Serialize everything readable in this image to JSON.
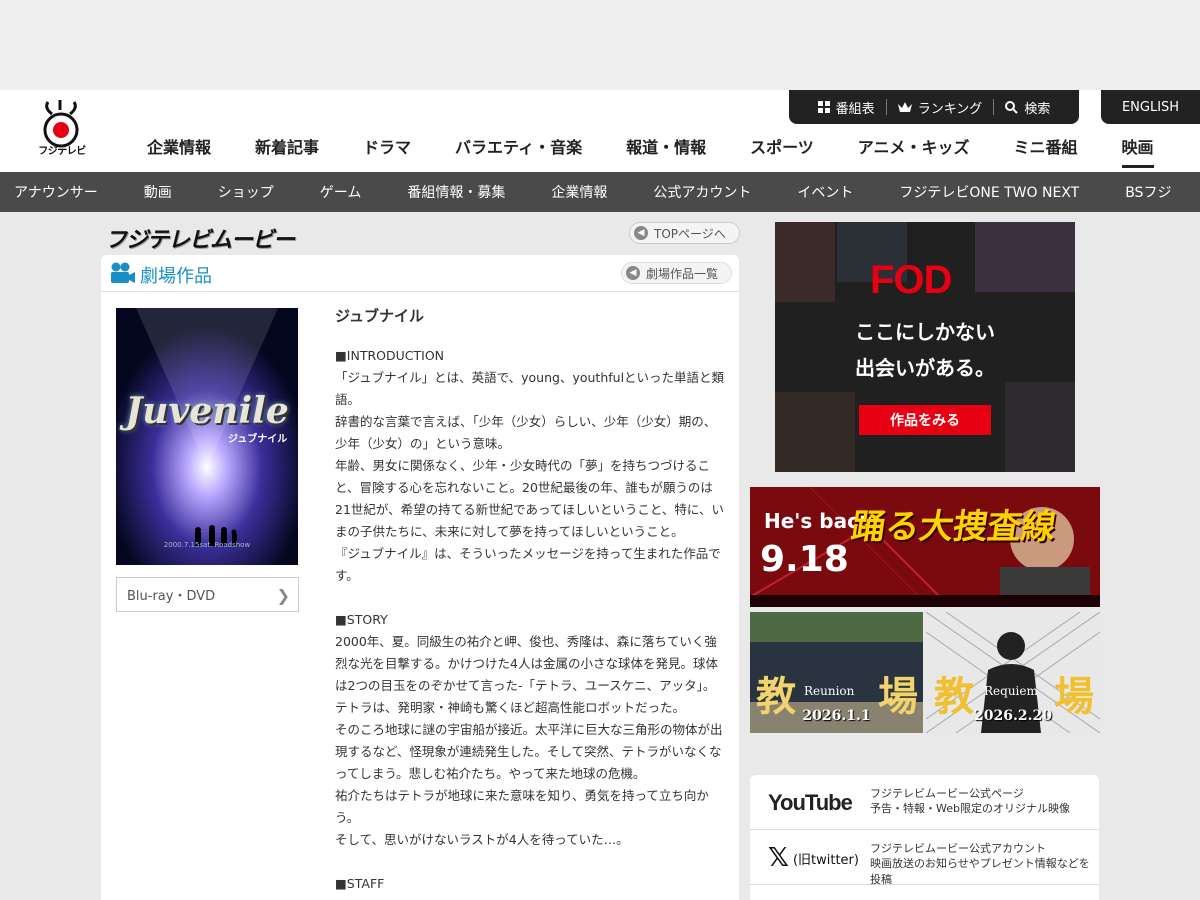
{
  "header": {
    "logo_text": "フジテレビ",
    "util": {
      "schedule": "番組表",
      "ranking": "ランキング",
      "search": "検索",
      "english": "ENGLISH"
    },
    "main_nav": [
      "企業情報",
      "新着記事",
      "ドラマ",
      "バラエティ・音楽",
      "報道・情報",
      "スポーツ",
      "アニメ・キッズ",
      "ミニ番組",
      "映画"
    ],
    "main_nav_active": "映画",
    "sub_nav": [
      "アナウンサー",
      "動画",
      "ショップ",
      "ゲーム",
      "番組情報・募集",
      "企業情報",
      "公式アカウント",
      "イベント",
      "フジテレビONE TWO NEXT",
      "BSフジ"
    ]
  },
  "site": {
    "title": "フジテレビムービー",
    "top_button": "TOPページへ"
  },
  "section": {
    "title": "劇場作品",
    "list_button": "劇場作品一覧"
  },
  "poster": {
    "title": "Juvenile",
    "subtitle": "ジュブナイル",
    "date": "2000.7.15sat. Roadshow"
  },
  "bluray_button": "Blu-ray・DVD",
  "article": {
    "title": "ジュブナイル",
    "intro_head": "■INTRODUCTION",
    "intro": [
      "「ジュブナイル」とは、英語で、young、youthfulといった単語と類語。",
      "辞書的な言葉で言えば、「少年（少女）らしい、少年（少女）期の、少年（少女）の」という意味。",
      "年齢、男女に関係なく、少年・少女時代の「夢」を持ちつづけること、冒険する心を忘れないこと。20世紀最後の年、誰もが願うのは21世紀が、希望の持てる新世紀であってほしいということ、特に、いまの子供たちに、未来に対して夢を持ってほしいということ。",
      "『ジュブナイル』は、そういったメッセージを持って生まれた作品です。"
    ],
    "story_head": "■STORY",
    "story": [
      "2000年、夏。同級生の祐介と岬、俊也、秀隆は、森に落ちていく強烈な光を目撃する。かけつけた4人は金属の小さな球体を発見。球体は2つの目玉をのぞかせて言った-「テトラ、ユースケニ、アッタ」。テトラは、発明家・神崎も驚くほど超高性能ロボットだった。",
      "そのころ地球に謎の宇宙船が接近。太平洋に巨大な三角形の物体が出現するなど、怪現象が連続発生した。そして突然、テトラがいなくなってしまう。悲しむ祐介たち。やって来た地球の危機。",
      "祐介たちはテトラが地球に来た意味を知り、勇気を持って立ち向かう。",
      "そして、思いがけないラストが4人を待っていた…。"
    ],
    "staff_head": "■STAFF"
  },
  "sidebar": {
    "fod": {
      "logo": "FOD",
      "line1": "ここにしかない",
      "line2": "出会いがある。",
      "button": "作品をみる"
    },
    "odoru": {
      "line1": "He's back.",
      "date": "9.18",
      "title": "踊る大捜査線"
    },
    "kyojo1": {
      "title1": "教",
      "title2": "場",
      "sub": "Reunion",
      "date": "2026.1.1"
    },
    "kyojo2": {
      "title1": "教",
      "title2": "場",
      "sub": "Requiem",
      "date": "2026.2.20"
    },
    "sns": [
      {
        "logo": "YouTube",
        "title": "フジテレビムービー公式ページ",
        "desc": "予告・特報・Web限定のオリジナル映像"
      },
      {
        "logo": "(旧twitter)",
        "title": "フジテレビムービー公式アカウント",
        "desc": "映画放送のお知らせやプレゼント情報などを投稿"
      }
    ]
  },
  "colors": {
    "accent_blue": "#1a8fc7",
    "fod_red": "#e60012",
    "subnav_bg": "#4a4a4a"
  }
}
